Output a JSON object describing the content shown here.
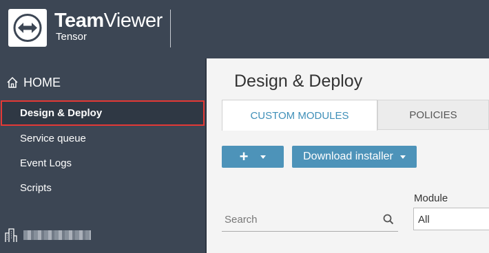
{
  "header": {
    "brand_bold": "Team",
    "brand_light": "Viewer",
    "product": "Tensor",
    "logo_icon": "teamviewer-logo-icon"
  },
  "sidebar": {
    "home_label": "HOME",
    "home_icon": "home-icon",
    "items": [
      {
        "label": "Design & Deploy",
        "active": true
      },
      {
        "label": "Service queue"
      },
      {
        "label": "Event Logs"
      },
      {
        "label": "Scripts"
      }
    ],
    "org_icon": "building-icon"
  },
  "main": {
    "title": "Design & Deploy",
    "tabs": [
      {
        "label": "CUSTOM MODULES",
        "active": true
      },
      {
        "label": "POLICIES"
      }
    ],
    "add_button_label": "+",
    "download_button_label": "Download installer",
    "search_placeholder": "Search",
    "module_label": "Module",
    "module_value": "All"
  },
  "colors": {
    "header_bg": "#3c4654",
    "accent": "#4d93b9",
    "active_tab_text": "#3e8fb8",
    "highlight_border": "#e53935"
  }
}
